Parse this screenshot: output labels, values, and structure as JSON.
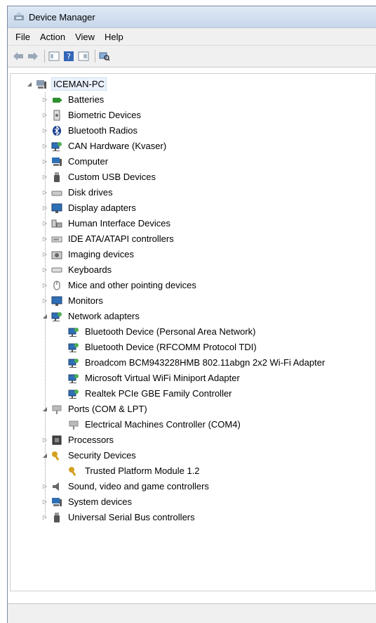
{
  "window": {
    "title": "Device Manager"
  },
  "menu": {
    "items": [
      "File",
      "Action",
      "View",
      "Help"
    ]
  },
  "tree": {
    "root": "ICEMAN-PC",
    "categories": [
      {
        "label": "Batteries",
        "icon": "battery-icon",
        "color": "#2f8f2f"
      },
      {
        "label": "Biometric Devices",
        "icon": "biometric-icon",
        "color": "#6b6b6b"
      },
      {
        "label": "Bluetooth Radios",
        "icon": "bluetooth-icon",
        "color": "#1a3d8f"
      },
      {
        "label": "CAN Hardware (Kvaser)",
        "icon": "network-icon",
        "color": "#2e6fb5"
      },
      {
        "label": "Computer",
        "icon": "computer-icon",
        "color": "#2e6fb5"
      },
      {
        "label": "Custom USB Devices",
        "icon": "usb-icon",
        "color": "#555555"
      },
      {
        "label": "Disk drives",
        "icon": "disk-icon",
        "color": "#777777"
      },
      {
        "label": "Display adapters",
        "icon": "display-icon",
        "color": "#2e6fb5"
      },
      {
        "label": "Human Interface Devices",
        "icon": "hid-icon",
        "color": "#666666"
      },
      {
        "label": "IDE ATA/ATAPI controllers",
        "icon": "ide-icon",
        "color": "#777777"
      },
      {
        "label": "Imaging devices",
        "icon": "camera-icon",
        "color": "#666666"
      },
      {
        "label": "Keyboards",
        "icon": "keyboard-icon",
        "color": "#777777"
      },
      {
        "label": "Mice and other pointing devices",
        "icon": "mouse-icon",
        "color": "#555555"
      },
      {
        "label": "Monitors",
        "icon": "monitor-icon",
        "color": "#2e6fb5"
      },
      {
        "label": "Network adapters",
        "icon": "network-icon",
        "color": "#2e6fb5",
        "expanded": true,
        "children": [
          "Bluetooth Device (Personal Area Network)",
          "Bluetooth Device (RFCOMM Protocol TDI)",
          "Broadcom BCM943228HMB 802.11abgn 2x2 Wi-Fi Adapter",
          "Microsoft Virtual WiFi Miniport Adapter",
          "Realtek PCIe GBE Family Controller"
        ]
      },
      {
        "label": "Ports (COM & LPT)",
        "icon": "port-icon",
        "color": "#888888",
        "expanded": true,
        "children": [
          "Electrical Machines Controller (COM4)"
        ]
      },
      {
        "label": "Processors",
        "icon": "processor-icon",
        "color": "#444444"
      },
      {
        "label": "Security Devices",
        "icon": "key-icon",
        "color": "#d4a020",
        "expanded": true,
        "children": [
          "Trusted Platform Module 1.2"
        ]
      },
      {
        "label": "Sound, video and game controllers",
        "icon": "speaker-icon",
        "color": "#666666"
      },
      {
        "label": "System devices",
        "icon": "computer-icon",
        "color": "#2e6fb5"
      },
      {
        "label": "Universal Serial Bus controllers",
        "icon": "usb-icon",
        "color": "#555555"
      }
    ]
  }
}
